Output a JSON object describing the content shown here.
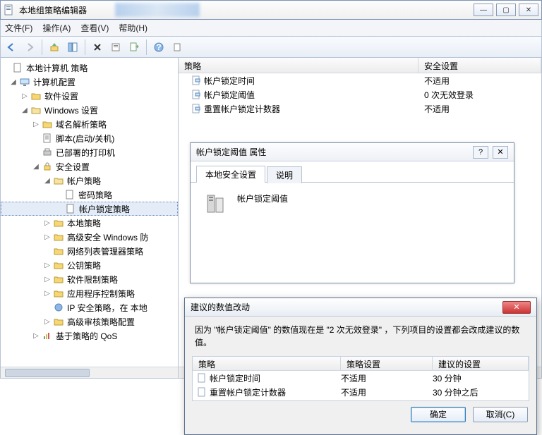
{
  "window": {
    "title": "本地组策略编辑器"
  },
  "menu": {
    "file": "文件(F)",
    "action": "操作(A)",
    "view": "查看(V)",
    "help": "帮助(H)"
  },
  "tree": {
    "root": "本地计算机 策略",
    "computer": "计算机配置",
    "soft": "软件设置",
    "winset": "Windows 设置",
    "dns": "域名解析策略",
    "script": "脚本(启动/关机)",
    "printer": "已部署的打印机",
    "security": "安全设置",
    "account": "帐户策略",
    "password": "密码策略",
    "lockout": "帐户锁定策略",
    "local": "本地策略",
    "wfas": "高级安全 Windows 防",
    "netlist": "网络列表管理器策略",
    "pubkey": "公钥策略",
    "softrest": "软件限制策略",
    "appctrl": "应用程序控制策略",
    "ipsec": "IP 安全策略，在 本地",
    "audit": "高级审核策略配置",
    "qos": "基于策略的 QoS"
  },
  "list": {
    "headers": {
      "policy": "策略",
      "setting": "安全设置"
    },
    "rows": [
      {
        "name": "帐户锁定时间",
        "setting": "不适用"
      },
      {
        "name": "帐户锁定阈值",
        "setting": "0 次无效登录"
      },
      {
        "name": "重置帐户锁定计数器",
        "setting": "不适用"
      }
    ]
  },
  "propDialog": {
    "title": "帐户锁定阈值 属性",
    "tab1": "本地安全设置",
    "tab2": "说明",
    "label": "帐户锁定阈值"
  },
  "suggDialog": {
    "title": "建议的数值改动",
    "message": "因为 \"帐户锁定阈值\" 的数值现在是 \"2 次无效登录\" ，下列项目的设置都会改成建议的数值。",
    "headers": {
      "policy": "策略",
      "setting": "策略设置",
      "suggest": "建议的设置"
    },
    "rows": [
      {
        "name": "帐户锁定时间",
        "setting": "不适用",
        "suggest": "30 分钟"
      },
      {
        "name": "重置帐户锁定计数器",
        "setting": "不适用",
        "suggest": "30 分钟之后"
      }
    ],
    "ok": "确定",
    "cancel": "取消(C)"
  }
}
